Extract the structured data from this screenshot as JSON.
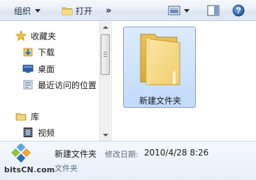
{
  "toolbar": {
    "organize_label": "组织",
    "open_label": "打开",
    "more_label": "»"
  },
  "nav": {
    "items": [
      {
        "label": "收藏夹",
        "icon": "star-icon"
      },
      {
        "label": "下载",
        "icon": "downloads-folder-icon"
      },
      {
        "label": "桌面",
        "icon": "desktop-icon"
      },
      {
        "label": "最近访问的位置",
        "icon": "recent-places-icon"
      },
      {
        "label": "库",
        "icon": "library-icon"
      },
      {
        "label": "视频",
        "icon": "video-library-icon"
      }
    ]
  },
  "content": {
    "items": [
      {
        "label": "新建文件夹",
        "icon": "folder-icon",
        "selected": true
      }
    ]
  },
  "details": {
    "name": "新建文件夹",
    "modified_label": "修改日期:",
    "modified_value": "2010/4/28 8:26",
    "type": "文件夹"
  },
  "watermark": {
    "text_main": "bitsCN",
    "text_dot": ".",
    "text_tail": "com"
  },
  "colors": {
    "selection_fill": "#c1dbfc",
    "selection_border": "#7da2ce",
    "folder": "#f3d47a"
  }
}
